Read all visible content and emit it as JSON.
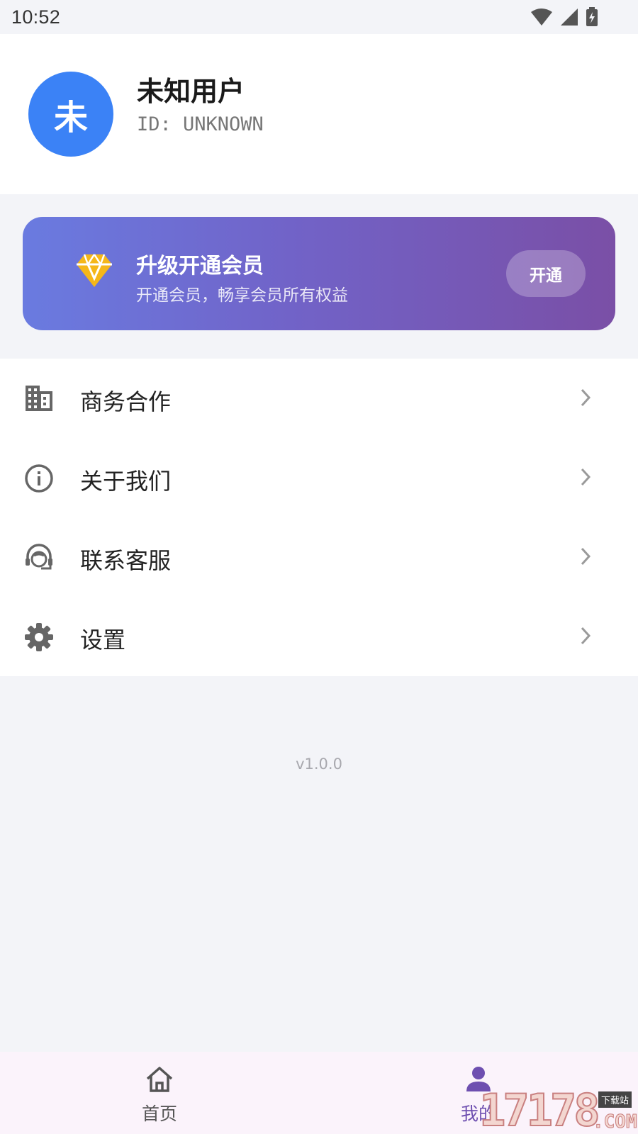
{
  "status_bar": {
    "time": "10:52",
    "icons": [
      "wifi-icon",
      "signal-icon",
      "battery-charging-icon"
    ]
  },
  "profile": {
    "avatar_char": "未",
    "name": "未知用户",
    "id_text": "ID: UNKNOWN",
    "avatar_color": "#3b82f6"
  },
  "vip": {
    "icon": "diamond-icon",
    "title": "升级开通会员",
    "subtitle": "开通会员，畅享会员所有权益",
    "button_label": "开通",
    "gradient": [
      "#6a7be0",
      "#7a4fa6"
    ]
  },
  "menu": {
    "items": [
      {
        "icon": "building-icon",
        "label": "商务合作"
      },
      {
        "icon": "info-icon",
        "label": "关于我们"
      },
      {
        "icon": "headset-icon",
        "label": "联系客服"
      },
      {
        "icon": "gear-icon",
        "label": "设置"
      }
    ]
  },
  "version": "v1.0.0",
  "bottom_nav": {
    "items": [
      {
        "icon": "home-icon",
        "label": "首页"
      },
      {
        "icon": "person-icon",
        "label": "我的",
        "active": true
      }
    ],
    "active_color": "#6e4fb0"
  },
  "watermark": {
    "digits": "17178",
    "tag": "下载站",
    "suffix": ".COM"
  }
}
